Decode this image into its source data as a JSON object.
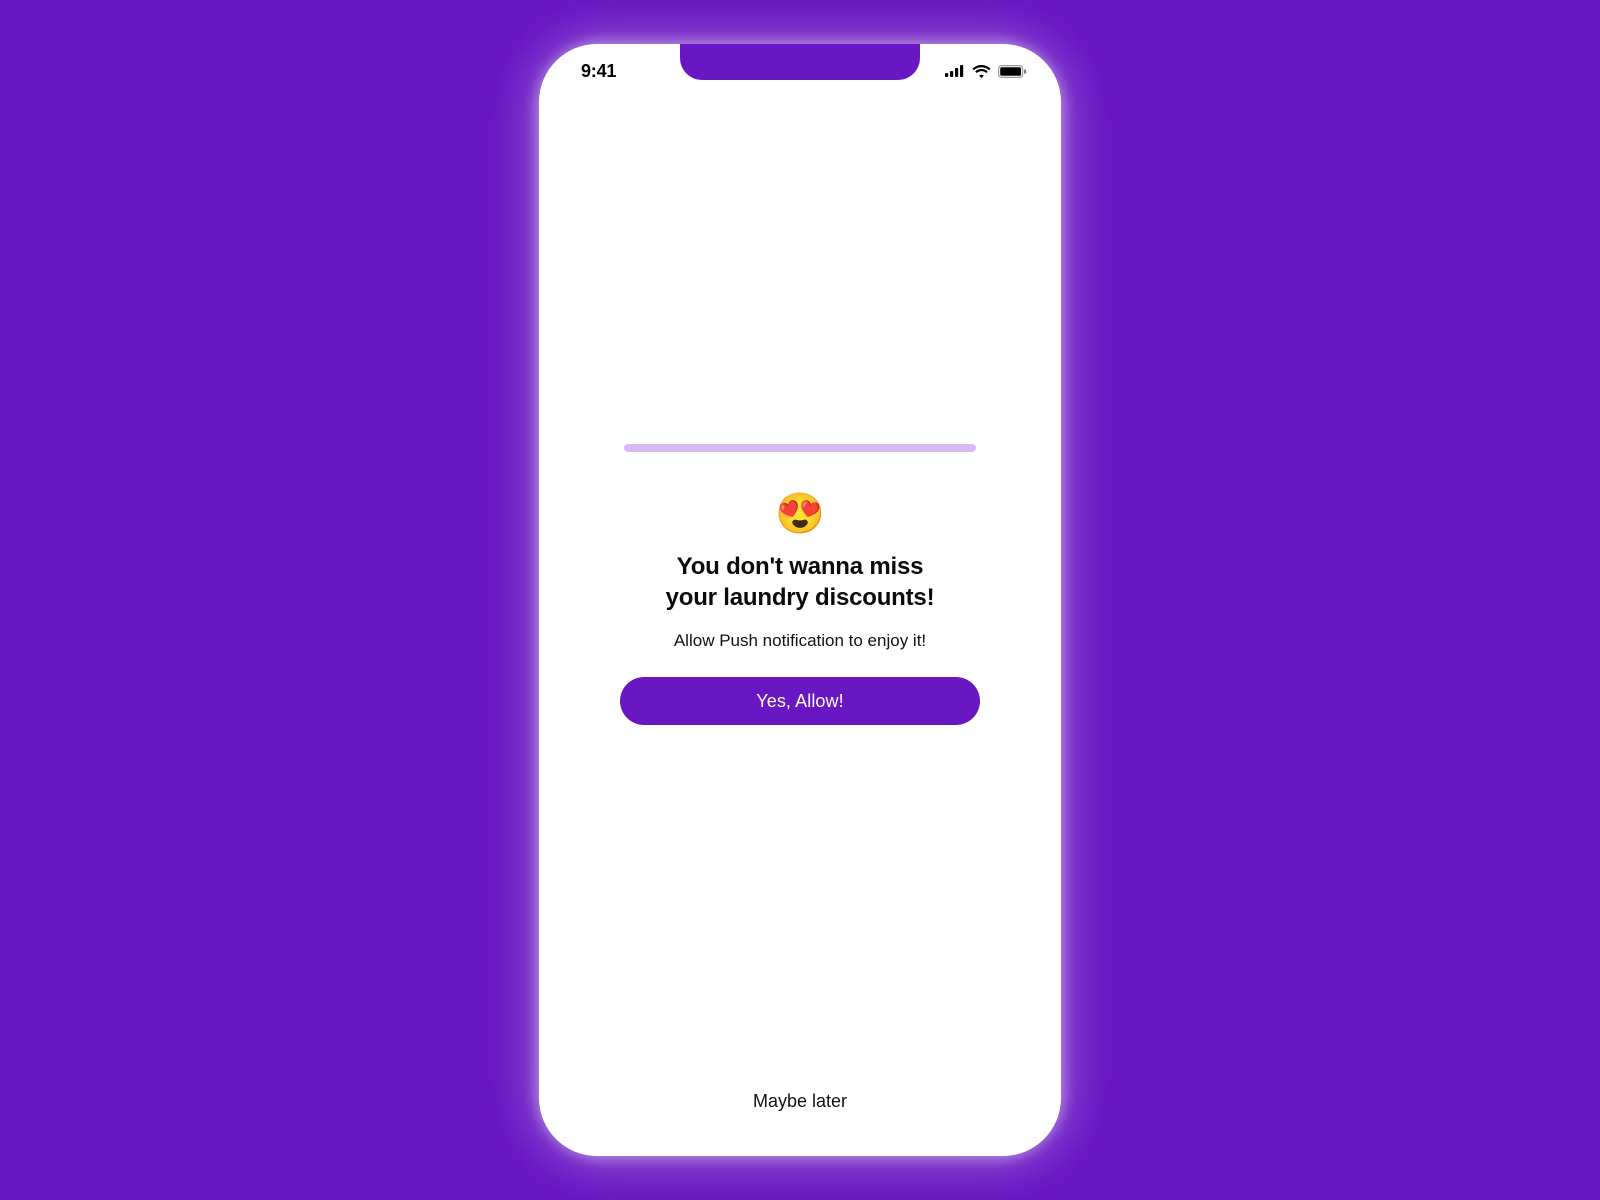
{
  "status": {
    "time": "9:41"
  },
  "prompt": {
    "emoji": "😍",
    "headline_line1": "You don't wanna miss",
    "headline_line2": "your laundry discounts!",
    "subtext": "Allow Push notification to enjoy it!",
    "primary_button": "Yes, Allow!",
    "secondary_button": "Maybe later"
  },
  "colors": {
    "background": "#6916c3",
    "progress": "#d7b7f4",
    "button": "#6916c3"
  }
}
